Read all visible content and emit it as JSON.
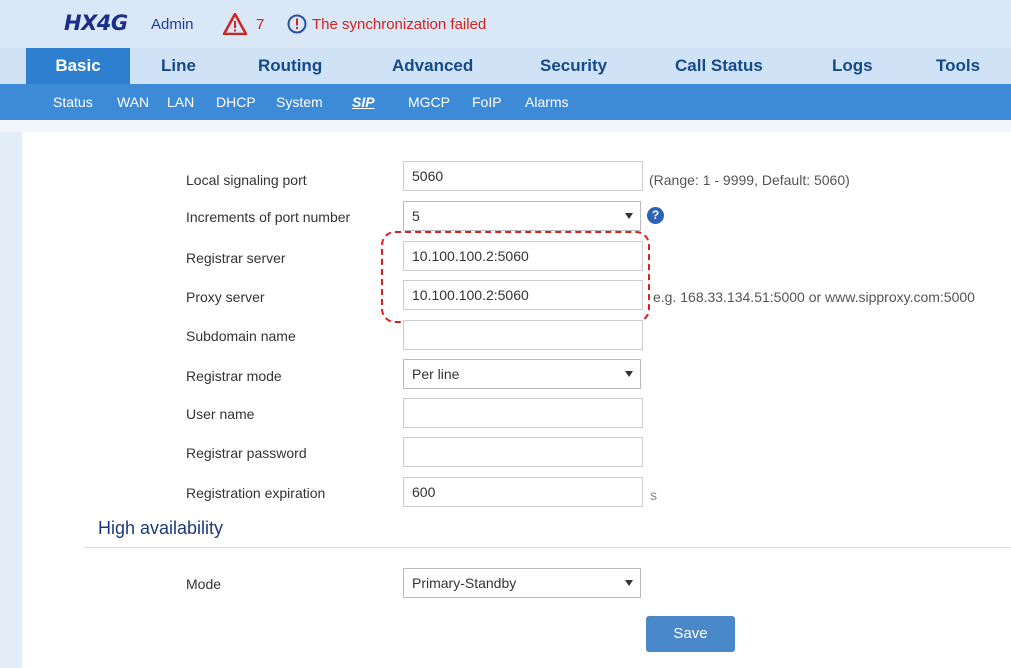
{
  "header": {
    "brand": "HX4G",
    "user": "Admin",
    "alarm_count": "7",
    "sync_message": "The synchronization failed",
    "alarm_color": "#d0231f"
  },
  "tabs": [
    {
      "label": "Basic",
      "active": true
    },
    {
      "label": "Line"
    },
    {
      "label": "Routing"
    },
    {
      "label": "Advanced"
    },
    {
      "label": "Security"
    },
    {
      "label": "Call Status"
    },
    {
      "label": "Logs"
    },
    {
      "label": "Tools"
    }
  ],
  "subnav": [
    {
      "label": "Status"
    },
    {
      "label": "WAN"
    },
    {
      "label": "LAN"
    },
    {
      "label": "DHCP"
    },
    {
      "label": "System"
    },
    {
      "label": "SIP",
      "active": true
    },
    {
      "label": "MGCP"
    },
    {
      "label": "FoIP"
    },
    {
      "label": "Alarms"
    }
  ],
  "form": {
    "local_port": {
      "label": "Local signaling port",
      "value": "5060",
      "hint": "(Range: 1 - 9999, Default: 5060)"
    },
    "port_increment": {
      "label": "Increments of port number",
      "value": "5",
      "help": "?"
    },
    "registrar_server": {
      "label": "Registrar server",
      "value": "10.100.100.2:5060"
    },
    "proxy_server": {
      "label": "Proxy server",
      "value": "10.100.100.2:5060",
      "hint": "e.g. 168.33.134.51:5000 or www.sipproxy.com:5000"
    },
    "subdomain": {
      "label": "Subdomain name",
      "value": ""
    },
    "registrar_mode": {
      "label": "Registrar mode",
      "value": "Per line"
    },
    "user_name": {
      "label": "User name",
      "value": ""
    },
    "registrar_password": {
      "label": "Registrar password",
      "value": ""
    },
    "registration_expiration": {
      "label": "Registration expiration",
      "value": "600",
      "unit": "s"
    }
  },
  "high_availability": {
    "title": "High availability",
    "mode": {
      "label": "Mode",
      "value": "Primary-Standby"
    }
  },
  "actions": {
    "save_label": "Save"
  },
  "colors": {
    "accent": "#2f7fd0",
    "highlight": "#e21b1b",
    "brand": "#1b2f8a"
  }
}
